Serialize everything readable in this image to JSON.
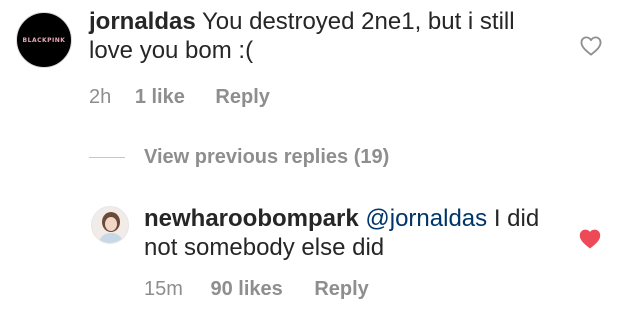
{
  "comments": [
    {
      "username": "jornaldas",
      "text": "You destroyed 2ne1, but i still love you bom :(",
      "mention": "",
      "avatar_logo_text": "BLACKPINK",
      "time": "2h",
      "likes": "1 like",
      "reply_label": "Reply",
      "liked": false
    },
    {
      "username": "newharoobompark",
      "mention": "@jornaldas",
      "text": "I did not somebody else did",
      "time": "15m",
      "likes": "90 likes",
      "reply_label": "Reply",
      "liked": true
    }
  ],
  "view_previous_replies": "View previous replies (19)",
  "icons": {
    "unliked_heart": "heart-outline-icon",
    "liked_heart": "heart-filled-icon"
  },
  "colors": {
    "heart_liked": "#ed4956",
    "heart_unliked": "#8e8e8e",
    "mention": "#003569",
    "meta_text": "#8e8e8e",
    "primary_text": "#262626"
  }
}
